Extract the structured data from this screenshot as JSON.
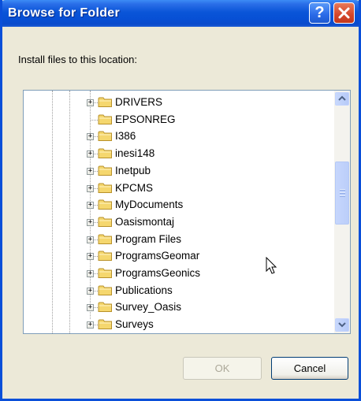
{
  "window": {
    "title": "Browse for Folder",
    "help_symbol": "?",
    "prompt": "Install files to this location:"
  },
  "tree": {
    "items": [
      {
        "label": "DRIVERS",
        "expandable": true
      },
      {
        "label": "EPSONREG",
        "expandable": false
      },
      {
        "label": "I386",
        "expandable": true
      },
      {
        "label": "inesi148",
        "expandable": true
      },
      {
        "label": "Inetpub",
        "expandable": true
      },
      {
        "label": "KPCMS",
        "expandable": true
      },
      {
        "label": "MyDocuments",
        "expandable": true
      },
      {
        "label": "Oasismontaj",
        "expandable": true
      },
      {
        "label": "Program Files",
        "expandable": true
      },
      {
        "label": "ProgramsGeomar",
        "expandable": true
      },
      {
        "label": "ProgramsGeonics",
        "expandable": true
      },
      {
        "label": "Publications",
        "expandable": true
      },
      {
        "label": "Survey_Oasis",
        "expandable": true
      },
      {
        "label": "Surveys",
        "expandable": true
      }
    ]
  },
  "buttons": {
    "ok_label": "OK",
    "cancel_label": "Cancel"
  },
  "colors": {
    "title_bar": "#0A55D8",
    "window_bg": "#ECE9D8",
    "folder_yellow": "#F5D76E"
  }
}
